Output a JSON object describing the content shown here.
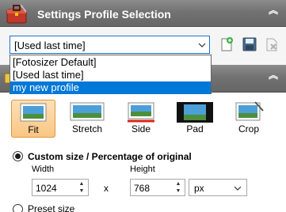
{
  "header": {
    "title": "Settings Profile Selection",
    "collapse_glyph": "︽",
    "icon": "toolbox-icon"
  },
  "profile_combo": {
    "value": "[Used last time]",
    "options": [
      "[Fotosizer Default]",
      "[Used last time]",
      "my new profile"
    ],
    "highlighted_option": "my new profile"
  },
  "toolbar": {
    "new_icon": "new-profile-icon",
    "save_icon": "save-icon",
    "delete_icon": "delete-icon"
  },
  "second_header": {
    "collapse_glyph": "︽"
  },
  "resize_modes": [
    {
      "label": "Fit",
      "icon": "fit-icon",
      "active": true
    },
    {
      "label": "Stretch",
      "icon": "stretch-icon",
      "active": false
    },
    {
      "label": "Side",
      "icon": "side-icon",
      "active": false
    },
    {
      "label": "Pad",
      "icon": "pad-icon",
      "active": false
    },
    {
      "label": "Crop",
      "icon": "crop-icon",
      "active": false
    }
  ],
  "size": {
    "custom_label": "Custom size / Percentage of original",
    "width_label": "Width",
    "height_label": "Height",
    "width_value": "1024",
    "height_value": "768",
    "times": "x",
    "unit": "px",
    "preset_label": "Preset size"
  },
  "colors": {
    "header_bg": "#767676",
    "selection_blue": "#0078d7",
    "active_mode_bg": "#f9c684"
  }
}
